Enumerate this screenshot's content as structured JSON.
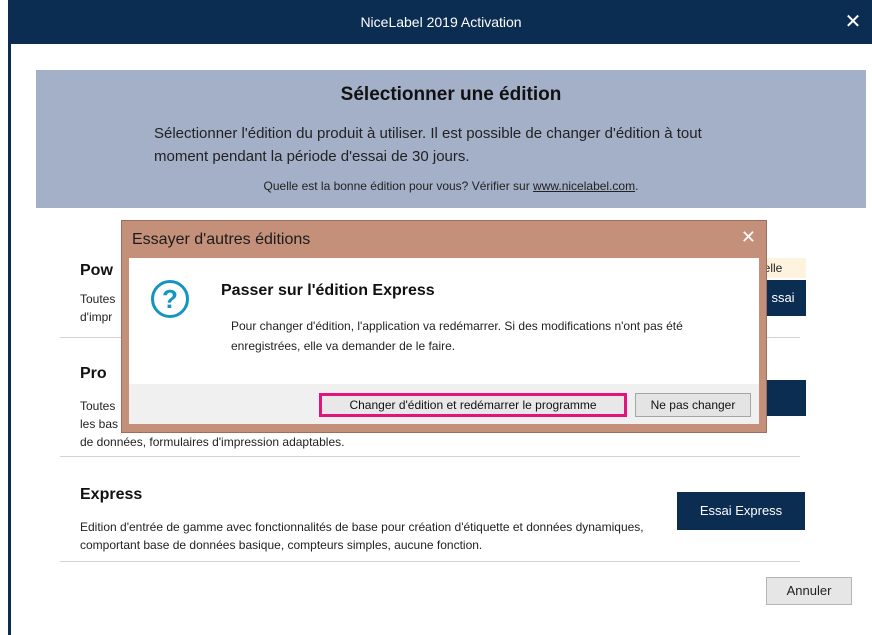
{
  "window": {
    "title": "NiceLabel 2019 Activation",
    "close_glyph": "✕"
  },
  "banner": {
    "heading": "Sélectionner une édition",
    "description": "Sélectionner l'édition du produit à utiliser. Il est possible de changer d'édition à tout moment pendant la période d'essai de 30 jours.",
    "which_prefix": "Quelle est la bonne édition pour vous? Vérifier sur ",
    "which_link": "www.nicelabel.com",
    "which_suffix": "."
  },
  "editions": {
    "powerforms": {
      "name_visible": "Pow",
      "text_line1": "Toutes",
      "text_line2": "d'impr",
      "tag": "uelle",
      "button": "ssai"
    },
    "pro": {
      "name": "Pro",
      "text_line1": "Toutes",
      "text_line2": "les bas",
      "text_line3": "de données, formulaires d'impression adaptables."
    },
    "express": {
      "name": "Express",
      "text": "Edition d'entrée de gamme avec fonctionnalités de base pour création d'étiquette et données dynamiques, comportant base de données basique, compteurs simples, aucune fonction.",
      "button": "Essai  Express"
    }
  },
  "cancel_button": "Annuler",
  "dialog": {
    "title": "Essayer d'autres éditions",
    "close_glyph": "✕",
    "icon_glyph": "?",
    "heading": "Passer sur l'édition Express",
    "message": "Pour changer d'édition, l'application va redémarrer. Si des modifications n'ont pas été enregistrées, elle va demander de le faire.",
    "change_button": "Changer d'édition et redémarrer le programme",
    "keep_button": "Ne pas changer"
  },
  "colors": {
    "titlebar": "#0c2d52",
    "banner": "#a3b0c8",
    "dialog_frame": "#c4907a",
    "highlight": "#e3157c",
    "icon": "#1296c0"
  }
}
